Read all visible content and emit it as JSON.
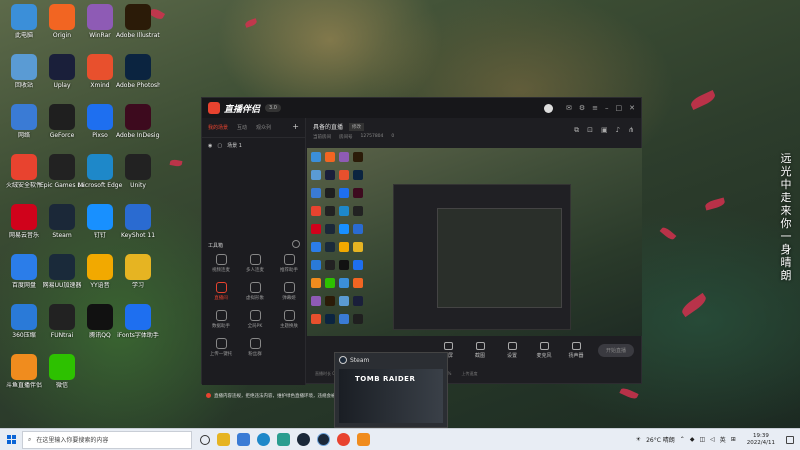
{
  "desktop": {
    "icons": [
      {
        "label": "此电脑",
        "icon": "computer-icon",
        "color": "#3b8fd9"
      },
      {
        "label": "Origin",
        "icon": "origin-icon",
        "color": "#f26522"
      },
      {
        "label": "WinRar",
        "icon": "winrar-icon",
        "color": "#8e5bb5"
      },
      {
        "label": "Adobe Illustrat...",
        "icon": "illustrator-icon",
        "color": "#2b1b08"
      },
      {
        "label": "回收站",
        "icon": "recycle-bin-icon",
        "color": "#5a9bd4"
      },
      {
        "label": "Uplay",
        "icon": "uplay-icon",
        "color": "#1a1f3a"
      },
      {
        "label": "Xmind",
        "icon": "xmind-icon",
        "color": "#e8502d"
      },
      {
        "label": "Adobe Photosh...",
        "icon": "photoshop-icon",
        "color": "#0b2440"
      },
      {
        "label": "网络",
        "icon": "network-icon",
        "color": "#3a7bd5"
      },
      {
        "label": "GeForce",
        "icon": "geforce-icon",
        "color": "#1f1f1f"
      },
      {
        "label": "Pixso",
        "icon": "pixso-icon",
        "color": "#1e6ff0"
      },
      {
        "label": "Adobe InDesign",
        "icon": "indesign-icon",
        "color": "#3d0a1e"
      },
      {
        "label": "火绒安全软件",
        "icon": "huorong-icon",
        "color": "#e8432f"
      },
      {
        "label": "Epic Games Launcher",
        "icon": "epic-icon",
        "color": "#222"
      },
      {
        "label": "Microsoft Edge",
        "icon": "edge-icon",
        "color": "#1e88c9"
      },
      {
        "label": "Unity",
        "icon": "unity-icon",
        "color": "#222"
      },
      {
        "label": "网易云音乐",
        "icon": "netease-music-icon",
        "color": "#d0021b"
      },
      {
        "label": "Steam",
        "icon": "steam-icon",
        "color": "#1b2838"
      },
      {
        "label": "钉钉",
        "icon": "dingtalk-icon",
        "color": "#1890ff"
      },
      {
        "label": "KeyShot 11",
        "icon": "keyshot-icon",
        "color": "#2a6bd1"
      },
      {
        "label": "百度网盘",
        "icon": "baidu-netdisk-icon",
        "color": "#2b7de9"
      },
      {
        "label": "网易UU加速器",
        "icon": "uu-icon",
        "color": "#1a2a3a"
      },
      {
        "label": "YY语音",
        "icon": "yy-icon",
        "color": "#f2a900"
      },
      {
        "label": "学习",
        "icon": "folder-icon",
        "color": "#e6b422"
      },
      {
        "label": "360压缩",
        "icon": "zip-icon",
        "color": "#2a7ad8"
      },
      {
        "label": "FUNtrai",
        "icon": "funtrai-icon",
        "color": "#222"
      },
      {
        "label": "腾讯QQ",
        "icon": "qq-icon",
        "color": "#111"
      },
      {
        "label": "iFonts字体助手",
        "icon": "ifonts-icon",
        "color": "#1e6ff0"
      },
      {
        "label": "斗鱼直播伴侣",
        "icon": "douyu-icon",
        "color": "#f08c1e"
      },
      {
        "label": "微信",
        "icon": "wechat-icon",
        "color": "#2dc100"
      }
    ],
    "vertical_text": "远光中走来你一身晴朗"
  },
  "app": {
    "brand": "直播伴侣",
    "version": "3.0",
    "sidebar_tabs": [
      "我的场景",
      "互动",
      "观众列"
    ],
    "scene_label": "场景 1",
    "tools_title": "工具箱",
    "tools": [
      {
        "label": "视频连麦",
        "icon": "video-link-icon",
        "red": false
      },
      {
        "label": "多人连麦",
        "icon": "multi-link-icon",
        "red": false
      },
      {
        "label": "推荐助手",
        "icon": "assistant-icon",
        "red": false
      },
      {
        "label": "直播间",
        "icon": "live-room-icon",
        "red": true
      },
      {
        "label": "虚拟形象",
        "icon": "avatar-tool-icon",
        "red": false
      },
      {
        "label": "弹幕姬",
        "icon": "danmaku-icon",
        "red": false
      },
      {
        "label": "数据助手",
        "icon": "data-icon",
        "red": false
      },
      {
        "label": "全局PK",
        "icon": "pk-icon",
        "red": false
      },
      {
        "label": "主题换肤",
        "icon": "theme-icon",
        "red": false
      },
      {
        "label": "上传一键托",
        "icon": "upload-icon",
        "red": false
      },
      {
        "label": "粉丝群",
        "icon": "fans-icon",
        "red": false
      }
    ],
    "warning": "直播内容违规，拒绝违法内容，维护绿色直播环境，违规会被封禁",
    "main_title": "具备的直播",
    "main_tag": "修改",
    "main_sub": [
      "当前房间",
      "房间号",
      "12757804",
      "0"
    ],
    "controls": [
      {
        "label": "录屏",
        "icon": "record-icon"
      },
      {
        "label": "截图",
        "icon": "screenshot-icon"
      },
      {
        "label": "设置",
        "icon": "settings-icon"
      },
      {
        "label": "麦克风",
        "icon": "mic-icon"
      },
      {
        "label": "扬声器",
        "icon": "speaker-icon"
      }
    ],
    "golive": "开始直播",
    "stats": [
      "直播时长 00:00",
      "FPS 60",
      "码率 0kb/s",
      "CPU 6%",
      "内存 12%",
      "上传速度"
    ]
  },
  "steam": {
    "title": "Steam",
    "game": "TOMB RAIDER"
  },
  "taskbar": {
    "search_placeholder": "在这里输入你要搜索的内容",
    "weather": "26°C 晴朗",
    "ime": "英",
    "time": "19:39",
    "date": "2022/4/11"
  }
}
